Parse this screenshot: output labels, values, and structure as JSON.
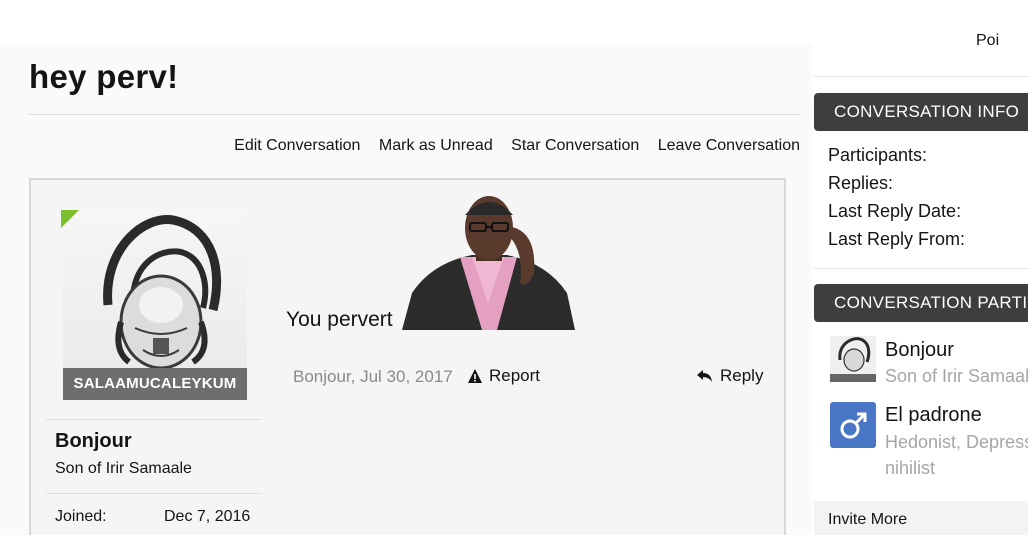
{
  "thread": {
    "title": "hey perv!"
  },
  "toolbar": {
    "edit": "Edit Conversation",
    "mark_unread": "Mark as Unread",
    "star": "Star Conversation",
    "leave": "Leave Conversation"
  },
  "message": {
    "author": {
      "name": "Bonjour",
      "title": "Son of Irir Samaale",
      "avatar_text": "SALAAMUCALEYKUM",
      "online": true,
      "joined_label": "Joined:",
      "joined_value": "Dec 7, 2016"
    },
    "text": "You pervert",
    "meta": "Bonjour, Jul 30, 2017",
    "report_label": "Report",
    "reply_label": "Reply"
  },
  "sidebar": {
    "top_cutoff_text": "Poi",
    "info_header": "CONVERSATION INFO",
    "info_labels": [
      "Participants:",
      "Replies:",
      "Last Reply Date:",
      "Last Reply From:"
    ],
    "participants_header": "CONVERSATION PARTICIPANTS",
    "participants": [
      {
        "name": "Bonjour",
        "title": "Son of Irir Samaale",
        "avatar": "salaam-avatar"
      },
      {
        "name": "El padrone",
        "title": "Hedonist, Depressed",
        "title_line2": "nihilist",
        "avatar": "male-symbol-avatar"
      }
    ],
    "invite_label": "Invite More"
  },
  "colors": {
    "sidebar_header_bg": "#3e3e3e",
    "online_indicator": "#7cbf2c",
    "male_avatar_bg": "#4a76c6",
    "muted_text": "#a6a6a6"
  }
}
